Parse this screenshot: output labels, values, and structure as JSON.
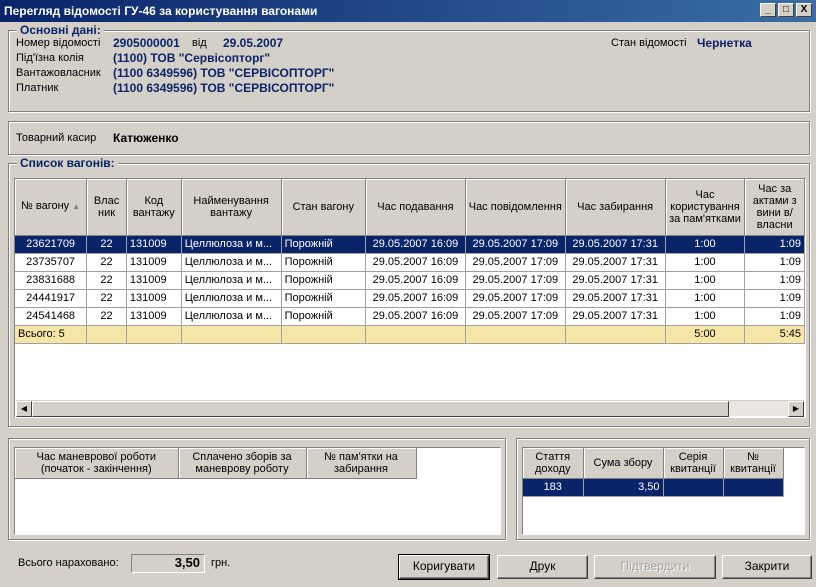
{
  "window": {
    "title": "Перегляд відомості ГУ-46 за користування вагонами",
    "minimize": "_",
    "maximize": "□",
    "close": "X"
  },
  "main_info": {
    "title": "Основні дані:",
    "number_label": "Номер відомості",
    "number_value": "2905000001",
    "from_label": "від",
    "date_value": "29.05.2007",
    "state_label": "Стан відомості",
    "state_value": "Чернетка",
    "siding_label": "Під'їзна колія",
    "siding_value": "(1100) ТОВ \"Сервісопторг\"",
    "owner_label": "Вантажовласник",
    "owner_value": "(1100 6349596) ТОВ \"СЕРВІСОПТОРГ\"",
    "payer_label": "Платник",
    "payer_value": "(1100 6349596) ТОВ \"СЕРВІСОПТОРГ\""
  },
  "cashier": {
    "label": "Товарний касир",
    "value": "Катюженко"
  },
  "wagons": {
    "title": "Список вагонів:",
    "columns": [
      "№ вагону",
      "Влас ник",
      "Код вантажу",
      "Найменування вантажу",
      "Стан вагону",
      "Час подавання",
      "Час повідомлення",
      "Час забирання",
      "Час користування за пам'ятками",
      "Час за актами з вини в/власни"
    ],
    "rows": [
      [
        "23621709",
        "22",
        "131009",
        "Целлюлоза и м...",
        "Порожній",
        "29.05.2007 16:09",
        "29.05.2007 17:09",
        "29.05.2007 17:31",
        "1:00",
        "1:09"
      ],
      [
        "23735707",
        "22",
        "131009",
        "Целлюлоза и м...",
        "Порожній",
        "29.05.2007 16:09",
        "29.05.2007 17:09",
        "29.05.2007 17:31",
        "1:00",
        "1:09"
      ],
      [
        "23831688",
        "22",
        "131009",
        "Целлюлоза и м...",
        "Порожній",
        "29.05.2007 16:09",
        "29.05.2007 17:09",
        "29.05.2007 17:31",
        "1:00",
        "1:09"
      ],
      [
        "24441917",
        "22",
        "131009",
        "Целлюлоза и м...",
        "Порожній",
        "29.05.2007 16:09",
        "29.05.2007 17:09",
        "29.05.2007 17:31",
        "1:00",
        "1:09"
      ],
      [
        "24541468",
        "22",
        "131009",
        "Целлюлоза и м...",
        "Порожній",
        "29.05.2007 16:09",
        "29.05.2007 17:09",
        "29.05.2007 17:31",
        "1:00",
        "1:09"
      ]
    ],
    "total_label": "Всього: 5",
    "total_usage": "5:00",
    "total_acts": "5:45"
  },
  "shunting": {
    "columns": [
      "Час маневрової роботи (початок - закінчення)",
      "Сплачено зборів за маневрову роботу",
      "№ пам'ятки на забирання"
    ]
  },
  "fees": {
    "columns": [
      "Стаття доходу",
      "Сума збору",
      "Серія квитанції",
      "№ квитанції"
    ],
    "rows": [
      [
        "183",
        "3,50",
        "",
        ""
      ]
    ]
  },
  "footer": {
    "total_label": "Всього нараховано:",
    "total_value": "3,50",
    "currency": "грн.",
    "edit_button": "Коригувати",
    "print_button": "Друк",
    "confirm_button": "Підтвердити",
    "close_button": "Закрити"
  },
  "colors": {
    "title_bar": "#0a246a",
    "selected_row": "#0a246a",
    "total_row": "#f5e6a8",
    "value_text": "#0a246a"
  }
}
